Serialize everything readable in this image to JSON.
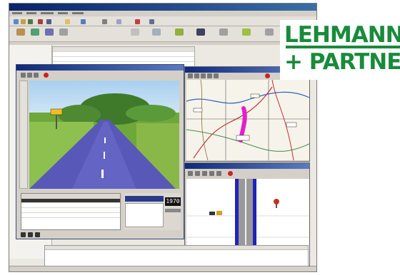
{
  "logo": {
    "line1": "LEHMANN",
    "line2": "+ PARTNER",
    "color": "#1a8a3c"
  },
  "speed": {
    "value": "1970"
  },
  "video_window": {
    "record_button_color": "#cc2222"
  },
  "road_window": {
    "record_button_color": "#cc2222"
  },
  "colors": {
    "window_chrome": "#d4d0c8",
    "titlebar": "#0a246a",
    "route_highlight": "#e020c8",
    "road_lane_edge": "#2222bb",
    "road_surface": "#999999"
  }
}
